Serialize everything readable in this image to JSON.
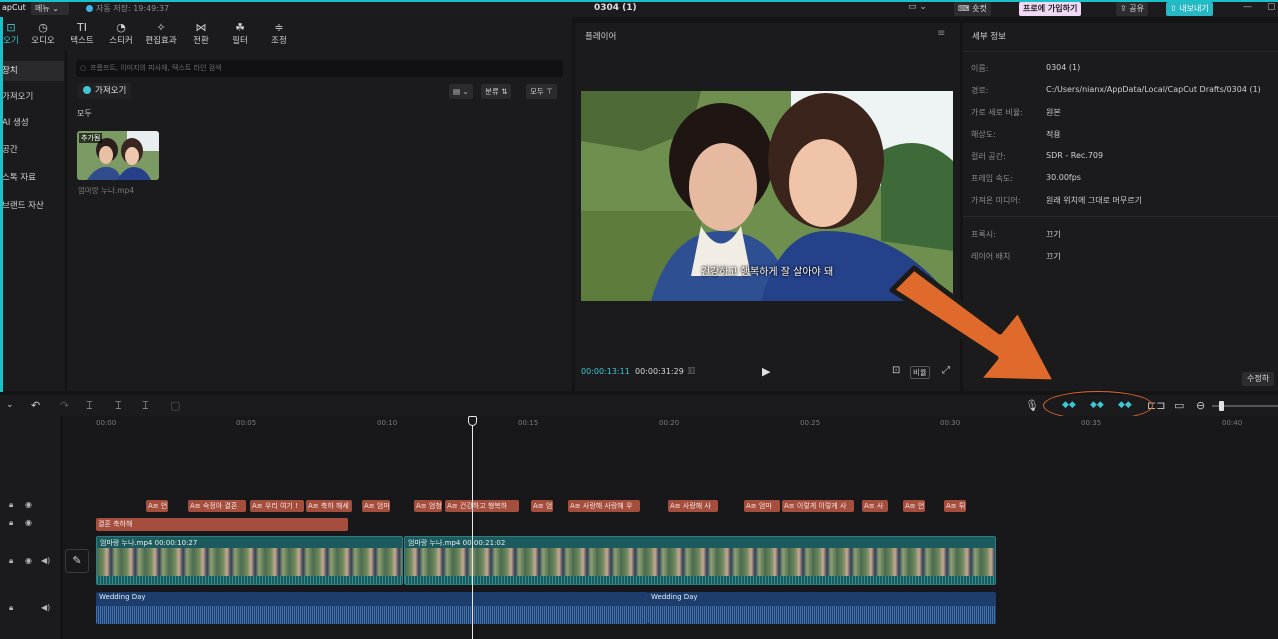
{
  "titlebar": {
    "logo": "apCut",
    "menu_label": "메뉴",
    "autosave": "자동 저장: 19:49:37",
    "title": "0304 (1)",
    "shortcut_label": "숏컷",
    "pro_label": "프로에 가입하기",
    "share_label": "공유",
    "export_label": "내보내기"
  },
  "toolbar": {
    "tools": [
      {
        "icon": "import-icon",
        "glyph": "⊡",
        "label": "오기"
      },
      {
        "icon": "audio-icon",
        "glyph": "◷",
        "label": "오디오"
      },
      {
        "icon": "text-icon",
        "glyph": "TI",
        "label": "텍스트"
      },
      {
        "icon": "sticker-icon",
        "glyph": "◔",
        "label": "스티커"
      },
      {
        "icon": "effects-icon",
        "glyph": "✧",
        "label": "편집효과"
      },
      {
        "icon": "transition-icon",
        "glyph": "⋈",
        "label": "전환"
      },
      {
        "icon": "filter-icon",
        "glyph": "☘",
        "label": "필터"
      },
      {
        "icon": "adjust-icon",
        "glyph": "≑",
        "label": "조정"
      }
    ]
  },
  "sidebar": {
    "items": [
      {
        "label": "장치"
      },
      {
        "label": "가져오기"
      },
      {
        "label": "AI 생성"
      },
      {
        "label": "공간"
      },
      {
        "label": "스톡 자료"
      },
      {
        "label": "브랜드 자산"
      }
    ]
  },
  "media": {
    "search_placeholder": "프롬프트, 이미지의 피사체, 텍스트 라인 검색",
    "import_label": "가져오기",
    "view_label": "▤ ⌄",
    "sort_label": "분류 ⇅",
    "all_filter_label": "모두 ⊤",
    "all_label": "모두",
    "thumb_tag": "추가됨",
    "file_name": "엄마랑 누나.mp4"
  },
  "player": {
    "title": "플레이어",
    "subtitle": "건강하고 행복하게 잘 살아야 돼",
    "current_time": "00:00:13:11",
    "total_time": "00:00:31:29",
    "ratio_label": "비율"
  },
  "details": {
    "title": "세부 정보",
    "rows": [
      {
        "label": "이름:",
        "value": "0304 (1)"
      },
      {
        "label": "경로:",
        "value": "C:/Users/nianx/AppData/Local/CapCut Drafts/0304 (1)"
      },
      {
        "label": "가로 세로 비율:",
        "value": "원본"
      },
      {
        "label": "해상도:",
        "value": "적용"
      },
      {
        "label": "컬러 공간:",
        "value": "SDR - Rec.709"
      },
      {
        "label": "프레임 속도:",
        "value": "30.00fps"
      },
      {
        "label": "가져온 미디어:",
        "value": "원래 위치에 그대로 머무르기"
      },
      {
        "label": "프록시:",
        "value": "끄기"
      },
      {
        "label": "레이어 배치",
        "value": "끄기"
      }
    ],
    "edit_label": "수정하"
  },
  "ruler": {
    "ticks": [
      "00:00",
      "00:05",
      "00:10",
      "00:15",
      "00:20",
      "00:25",
      "00:30",
      "00:35",
      "00:40"
    ]
  },
  "timeline": {
    "text_clips": [
      "A≡ 언",
      "A≡ 숙정아 결혼 ",
      "A≡ 우리 여기 !",
      "A≡ 축하 해세",
      "A≡ 엄마",
      "A≡ 엄청",
      "A≡ 건강하고 행복하",
      "A≡ 엄",
      "A≡ 사랑해 사랑해 우",
      "A≡ 사랑해 사",
      "A≡ 엄마",
      "A≡ 이렇게 이렇게 사",
      "A≡ 사",
      "A≡ 언",
      "A≡ 튀"
    ],
    "title_clip": "결혼 축하해",
    "video_clips": [
      {
        "name": "엄마랑 누나.mp4",
        "duration": "00:00:10:27"
      },
      {
        "name": "엄마랑 누나.mp4",
        "duration": "00:00:21:02"
      }
    ],
    "audio_clips": [
      {
        "name": "Wedding Day"
      },
      {
        "name": "Wedding Day"
      }
    ]
  },
  "colors": {
    "accent": "#3fc7d2",
    "text_clip": "#a64e3d",
    "video_clip": "#1c5a5d",
    "audio_clip": "#1d3e6d",
    "annotation": "#d9692e"
  }
}
